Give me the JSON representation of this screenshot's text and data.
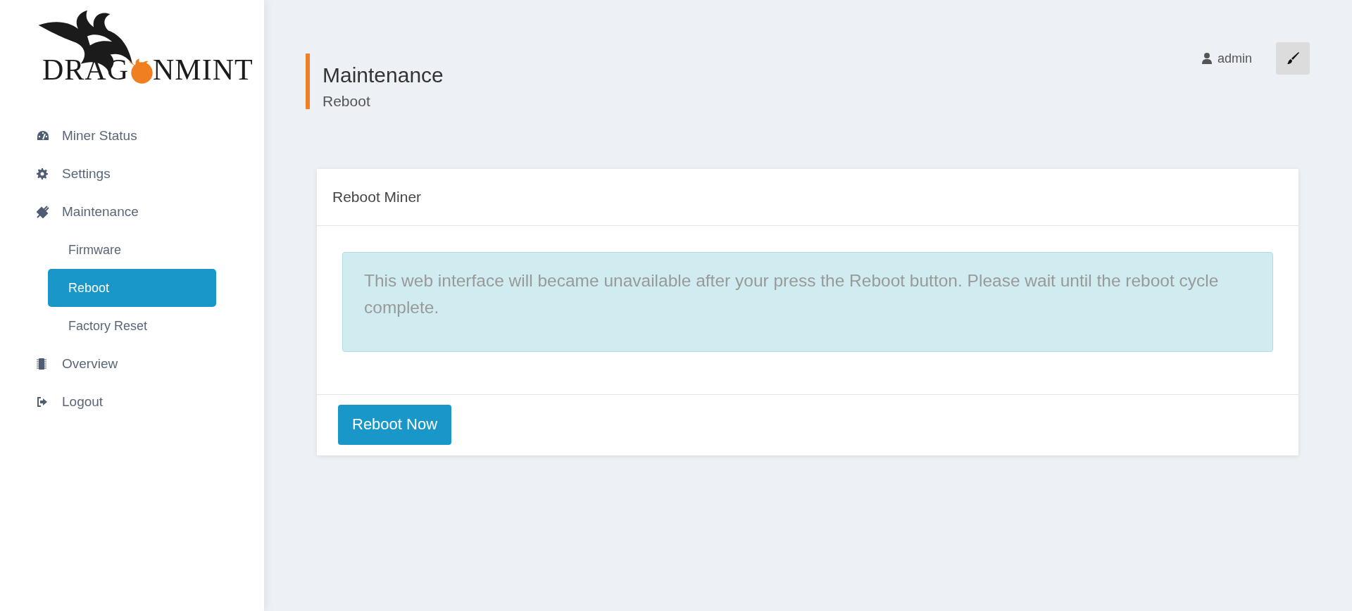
{
  "logo": {
    "text_before": "DRAG",
    "text_after": "NMINT"
  },
  "sidebar": {
    "items": [
      {
        "label": "Miner Status",
        "selected": false
      },
      {
        "label": "Settings",
        "selected": false
      },
      {
        "label": "Maintenance",
        "selected": false,
        "children": [
          {
            "label": "Firmware",
            "selected": false
          },
          {
            "label": "Reboot",
            "selected": true
          },
          {
            "label": "Factory Reset",
            "selected": false
          }
        ]
      },
      {
        "label": "Overview",
        "selected": false
      },
      {
        "label": "Logout",
        "selected": false
      }
    ]
  },
  "header": {
    "title": "Maintenance",
    "subtitle": "Reboot",
    "user": "admin"
  },
  "card": {
    "title": "Reboot Miner",
    "alert": "This web interface will became unavailable after your press the Reboot button. Please wait until the reboot cycle complete.",
    "button": "Reboot Now"
  }
}
